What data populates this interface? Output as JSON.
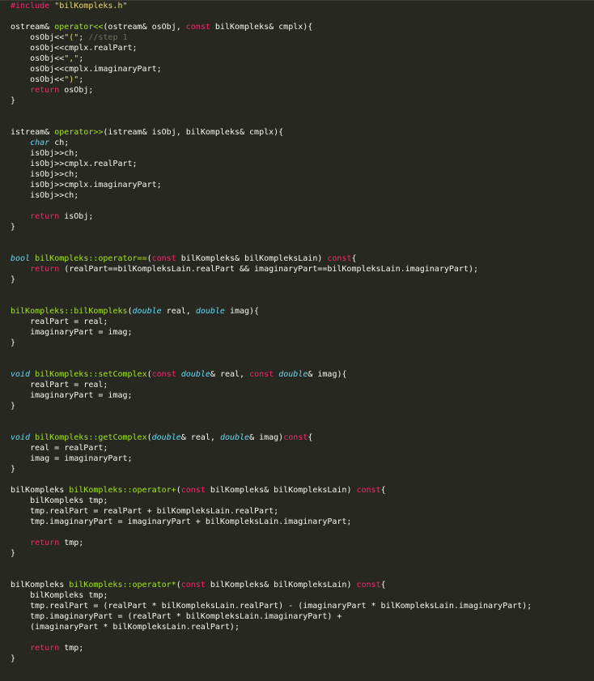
{
  "theme": {
    "background": "#272822",
    "text": "#f8f8f2",
    "keyword": "#f92672",
    "type": "#66d9ef",
    "function": "#a6e22e",
    "string": "#e6db74",
    "comment": "#75715e",
    "number": "#ae81ff"
  },
  "lines": [
    [
      [
        "pre",
        "#include "
      ],
      [
        "str",
        "\"bilKompleks.h\""
      ]
    ],
    [],
    [
      [
        "text",
        "ostream& "
      ],
      [
        "func",
        "operator<<"
      ],
      [
        "text",
        "(ostream& osObj, "
      ],
      [
        "kw",
        "const"
      ],
      [
        "text",
        " bilKompleks& cmplx){"
      ]
    ],
    [
      [
        "text",
        "    osObj<<"
      ],
      [
        "str",
        "\"(\""
      ],
      [
        "text",
        "; "
      ],
      [
        "com",
        "//step 1"
      ]
    ],
    [
      [
        "text",
        "    osObj<<cmplx.realPart;"
      ]
    ],
    [
      [
        "text",
        "    osObj<<"
      ],
      [
        "str",
        "\",\""
      ],
      [
        "text",
        ";"
      ]
    ],
    [
      [
        "text",
        "    osObj<<cmplx.imaginaryPart;"
      ]
    ],
    [
      [
        "text",
        "    osObj<<"
      ],
      [
        "str",
        "\")\""
      ],
      [
        "text",
        ";"
      ]
    ],
    [
      [
        "text",
        "    "
      ],
      [
        "kw",
        "return"
      ],
      [
        "text",
        " osObj;"
      ]
    ],
    [
      [
        "text",
        "}"
      ]
    ],
    [],
    [],
    [
      [
        "text",
        "istream& "
      ],
      [
        "func",
        "operator>>"
      ],
      [
        "text",
        "(istream& isObj, bilKompleks& cmplx){"
      ]
    ],
    [
      [
        "text",
        "    "
      ],
      [
        "type",
        "char"
      ],
      [
        "text",
        " ch;"
      ]
    ],
    [
      [
        "text",
        "    isObj>>ch;"
      ]
    ],
    [
      [
        "text",
        "    isObj>>cmplx.realPart;"
      ]
    ],
    [
      [
        "text",
        "    isObj>>ch;"
      ]
    ],
    [
      [
        "text",
        "    isObj>>cmplx.imaginaryPart;"
      ]
    ],
    [
      [
        "text",
        "    isObj>>ch;"
      ]
    ],
    [],
    [
      [
        "text",
        "    "
      ],
      [
        "kw",
        "return"
      ],
      [
        "text",
        " isObj;"
      ]
    ],
    [
      [
        "text",
        "}"
      ]
    ],
    [],
    [],
    [
      [
        "type",
        "bool"
      ],
      [
        "text",
        " "
      ],
      [
        "func",
        "bilKompleks::operator=="
      ],
      [
        "text",
        "("
      ],
      [
        "kw",
        "const"
      ],
      [
        "text",
        " bilKompleks& bilKompleksLain) "
      ],
      [
        "kw",
        "const"
      ],
      [
        "text",
        "{"
      ]
    ],
    [
      [
        "text",
        "    "
      ],
      [
        "kw",
        "return"
      ],
      [
        "text",
        " (realPart==bilKompleksLain.realPart && imaginaryPart==bilKompleksLain.imaginaryPart);"
      ]
    ],
    [
      [
        "text",
        "}"
      ]
    ],
    [],
    [],
    [
      [
        "func",
        "bilKompleks::bilKompleks"
      ],
      [
        "text",
        "("
      ],
      [
        "type",
        "double"
      ],
      [
        "text",
        " real, "
      ],
      [
        "type",
        "double"
      ],
      [
        "text",
        " imag){"
      ]
    ],
    [
      [
        "text",
        "    realPart = real;"
      ]
    ],
    [
      [
        "text",
        "    imaginaryPart = imag;"
      ]
    ],
    [
      [
        "text",
        "}"
      ]
    ],
    [],
    [],
    [
      [
        "type",
        "void"
      ],
      [
        "text",
        " "
      ],
      [
        "func",
        "bilKompleks::setComplex"
      ],
      [
        "text",
        "("
      ],
      [
        "kw",
        "const"
      ],
      [
        "text",
        " "
      ],
      [
        "type",
        "double"
      ],
      [
        "text",
        "& real, "
      ],
      [
        "kw",
        "const"
      ],
      [
        "text",
        " "
      ],
      [
        "type",
        "double"
      ],
      [
        "text",
        "& imag){"
      ]
    ],
    [
      [
        "text",
        "    realPart = real;"
      ]
    ],
    [
      [
        "text",
        "    imaginaryPart = imag;"
      ]
    ],
    [
      [
        "text",
        "}"
      ]
    ],
    [],
    [],
    [
      [
        "type",
        "void"
      ],
      [
        "text",
        " "
      ],
      [
        "func",
        "bilKompleks::getComplex"
      ],
      [
        "text",
        "("
      ],
      [
        "type",
        "double"
      ],
      [
        "text",
        "& real, "
      ],
      [
        "type",
        "double"
      ],
      [
        "text",
        "& imag)"
      ],
      [
        "kw",
        "const"
      ],
      [
        "text",
        "{"
      ]
    ],
    [
      [
        "text",
        "    real = realPart;"
      ]
    ],
    [
      [
        "text",
        "    imag = imaginaryPart;"
      ]
    ],
    [
      [
        "text",
        "}"
      ]
    ],
    [],
    [
      [
        "text",
        "bilKompleks "
      ],
      [
        "func",
        "bilKompleks::operator+"
      ],
      [
        "text",
        "("
      ],
      [
        "kw",
        "const"
      ],
      [
        "text",
        " bilKompleks& bilKompleksLain) "
      ],
      [
        "kw",
        "const"
      ],
      [
        "text",
        "{"
      ]
    ],
    [
      [
        "text",
        "    bilKompleks tmp;"
      ]
    ],
    [
      [
        "text",
        "    tmp.realPart = realPart + bilKompleksLain.realPart;"
      ]
    ],
    [
      [
        "text",
        "    tmp.imaginaryPart = imaginaryPart + bilKompleksLain.imaginaryPart;"
      ]
    ],
    [],
    [
      [
        "text",
        "    "
      ],
      [
        "kw",
        "return"
      ],
      [
        "text",
        " tmp;"
      ]
    ],
    [
      [
        "text",
        "}"
      ]
    ],
    [],
    [],
    [
      [
        "text",
        "bilKompleks "
      ],
      [
        "func",
        "bilKompleks::operator*"
      ],
      [
        "text",
        "("
      ],
      [
        "kw",
        "const"
      ],
      [
        "text",
        " bilKompleks& bilKompleksLain) "
      ],
      [
        "kw",
        "const"
      ],
      [
        "text",
        "{"
      ]
    ],
    [
      [
        "text",
        "    bilKompleks tmp;"
      ]
    ],
    [
      [
        "text",
        "    tmp.realPart = (realPart * bilKompleksLain.realPart) - (imaginaryPart * bilKompleksLain.imaginaryPart);"
      ]
    ],
    [
      [
        "text",
        "    tmp.imaginaryPart = (realPart * bilKompleksLain.imaginaryPart) +"
      ]
    ],
    [
      [
        "text",
        "    (imaginaryPart * bilKompleksLain.realPart);"
      ]
    ],
    [],
    [
      [
        "text",
        "    "
      ],
      [
        "kw",
        "return"
      ],
      [
        "text",
        " tmp;"
      ]
    ],
    [
      [
        "text",
        "}"
      ]
    ]
  ]
}
